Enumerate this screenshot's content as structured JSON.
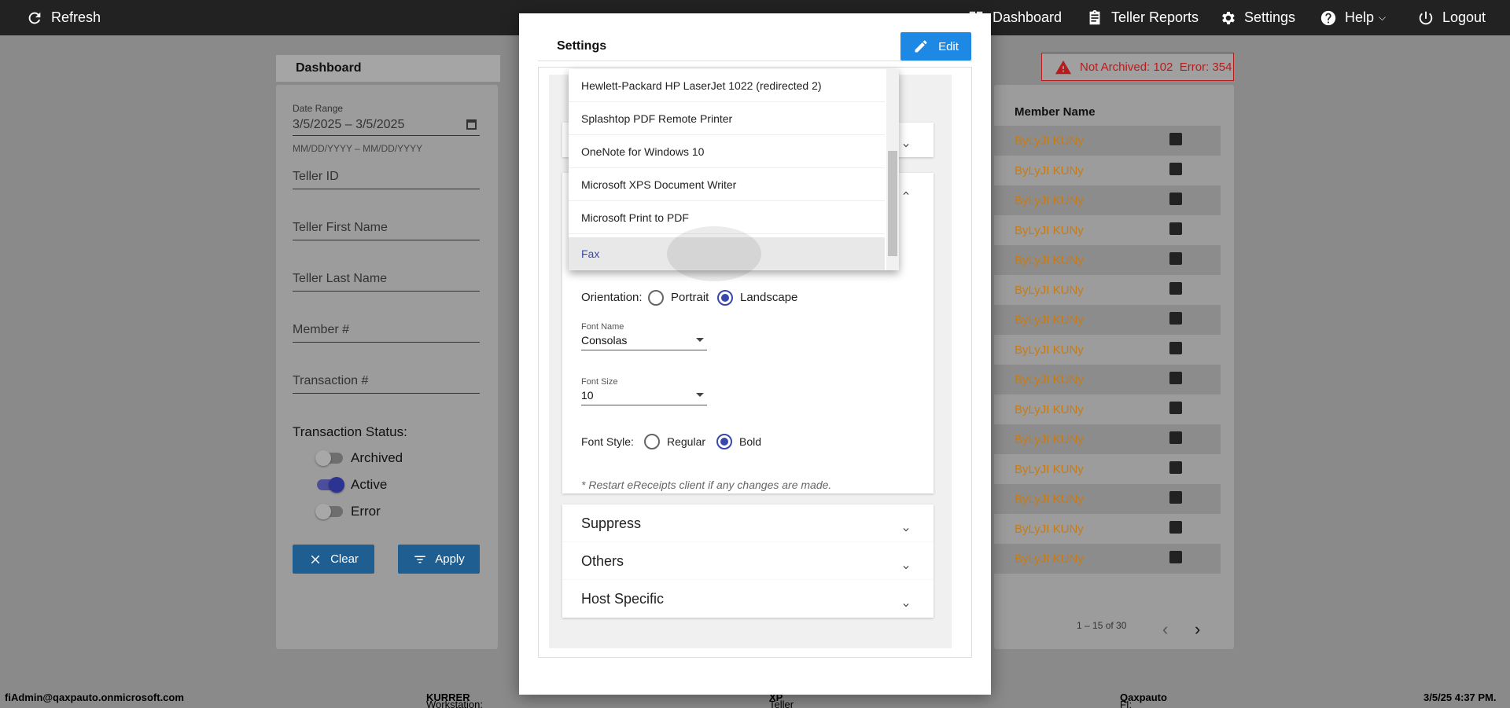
{
  "topbar": {
    "refresh_label": "Refresh",
    "nav": [
      {
        "label": "Dashboard",
        "icon": "dashboard-icon"
      },
      {
        "label": "Teller Reports",
        "icon": "clipboard-icon"
      },
      {
        "label": "Settings",
        "icon": "gear-icon"
      },
      {
        "label": "Help",
        "icon": "help-icon"
      },
      {
        "label": "Logout",
        "icon": "power-icon"
      }
    ]
  },
  "dashboard": {
    "title": "Dashboard",
    "filters": {
      "date_range_label": "Date Range",
      "date_range_value": "3/5/2025 – 3/5/2025",
      "date_range_hint": "MM/DD/YYYY – MM/DD/YYYY",
      "teller_id": "Teller ID",
      "teller_first_name": "Teller First Name",
      "teller_last_name": "Teller Last Name",
      "member_number": "Member #",
      "transaction_number": "Transaction #",
      "status_label": "Transaction Status:",
      "statuses": [
        {
          "label": "Archived",
          "on": false
        },
        {
          "label": "Active",
          "on": true
        },
        {
          "label": "Error",
          "on": false
        }
      ],
      "clear_label": "Clear",
      "apply_label": "Apply"
    },
    "error_badge": "Not Archived: 102  Error: 354",
    "table": {
      "column": "Member Name",
      "rows": [
        "ByLyJI KUNy",
        "ByLyJI KUNy",
        "ByLyJI KUNy",
        "ByLyJI KUNy",
        "ByLyJI KUNy",
        "ByLyJI KUNy",
        "ByLyJI KUNy",
        "ByLyJI KUNy",
        "ByLyJI KUNy",
        "ByLyJI KUNy",
        "ByLyJI KUNy",
        "ByLyJI KUNy",
        "ByLyJI KUNy",
        "ByLyJI KUNy",
        "ByLyJI KUNy"
      ]
    },
    "pager": "1 – 15 of 30"
  },
  "modal": {
    "title": "Settings",
    "edit_label": "Edit",
    "printer_options": [
      "Hewlett-Packard HP LaserJet 1022 (redirected 2)",
      "Splashtop PDF Remote Printer",
      "OneNote for Windows 10",
      "Microsoft XPS Document Writer",
      "Microsoft Print to PDF",
      "Fax"
    ],
    "selected_printer": "Fax",
    "orientation_label": "Orientation:",
    "orientation_options": [
      "Portrait",
      "Landscape"
    ],
    "orientation_selected": "Landscape",
    "font_name_label": "Font Name",
    "font_name_value": "Consolas",
    "font_size_label": "Font Size",
    "font_size_value": "10",
    "font_style_label": "Font Style:",
    "font_style_options": [
      "Regular",
      "Bold"
    ],
    "font_style_selected": "Bold",
    "note": "* Restart eReceipts client if any changes are made.",
    "sections": [
      "Suppress",
      "Others",
      "Host Specific"
    ]
  },
  "footer": {
    "user": "fiAdmin@qaxpauto.onmicrosoft.com",
    "workstation_label": "Workstation:",
    "workstation_value": "KURRER",
    "platform_label": "Teller Platform:",
    "platform_value": "XP",
    "fi_label": "FI:",
    "fi_value": "Qaxpauto",
    "datetime": "3/5/25 4:37 PM."
  },
  "colors": {
    "accent": "#1e88e5",
    "error": "#b71c1c",
    "member_name": "#c77b17",
    "selected": "#3949ab"
  }
}
